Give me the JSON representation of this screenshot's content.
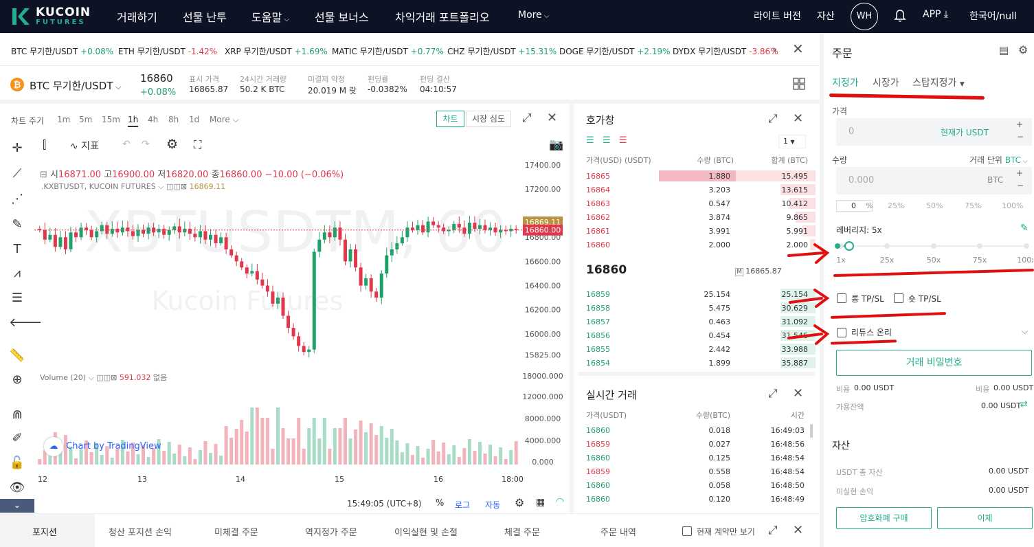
{
  "brand": {
    "name": "KUCOIN",
    "sub": "FUTURES"
  },
  "nav": {
    "items": [
      "거래하기",
      "선물 난투",
      "도움말",
      "선물 보너스",
      "차익거래 포트폴리오",
      "More"
    ],
    "right": [
      "라이트 버전",
      "자산"
    ],
    "avatar": "WH",
    "app": "APP",
    "lang": "한국어/null"
  },
  "ticker": [
    {
      "sym": "BTC 무기한/USDT",
      "chg": "+0.08%"
    },
    {
      "sym": "ETH 무기한/USDT",
      "chg": "-1.42%"
    },
    {
      "sym": "XRP 무기한/USDT",
      "chg": "+1.69%"
    },
    {
      "sym": "MATIC 무기한/USDT",
      "chg": "+0.77%"
    },
    {
      "sym": "CHZ 무기한/USDT",
      "chg": "+15.31%"
    },
    {
      "sym": "DOGE 무기한/USDT",
      "chg": "+2.19%"
    },
    {
      "sym": "DYDX 무기한/USDT",
      "chg": "-3.86%"
    }
  ],
  "summary": {
    "pair": "BTC 무기한/USDT",
    "last": "16860",
    "chg": "+0.08%",
    "stats": [
      {
        "label": "표시 가격",
        "value": "16865.87"
      },
      {
        "label": "24시간 거래량",
        "value": "50.2 K BTC"
      },
      {
        "label": "미결제 약정",
        "value": "20.019 M 랏"
      },
      {
        "label": "펀딩률",
        "value": "-0.0382%"
      },
      {
        "label": "펀딩 결산",
        "value": "04:10:57"
      }
    ]
  },
  "chart": {
    "period_label": "차트 주기",
    "intervals": [
      "1m",
      "5m",
      "15m",
      "1h",
      "4h",
      "8h",
      "1d",
      "More"
    ],
    "active_interval": "1h",
    "view_tabs": [
      "차트",
      "시장 심도"
    ],
    "indicator_label": "지표",
    "ohlc": {
      "o_label": "시",
      "o": "16871.00",
      "h_label": "고",
      "h": "16900.00",
      "l_label": "저",
      "l": "16820.00",
      "c_label": "종",
      "c": "16860.00",
      "chg": "−10.00 (−0.06%)"
    },
    "symbol_line": ".KXBTUSDT, KUCOIN FUTURES",
    "symbol_price": "16869.11",
    "watermark": "XBTUSDTM, 60",
    "watermark2": "Kucoin Futures",
    "price_ticks": [
      "17400.00",
      "17200.00",
      "16800.00",
      "16600.00",
      "16400.00",
      "16200.00",
      "16000.00",
      "15825.00"
    ],
    "tag_mark": "16869.11",
    "tag_last": "16860.00",
    "volume_label": "Volume (20)",
    "volume_value": "591.032",
    "volume_na": "없음",
    "vol_ticks": [
      "18000.000",
      "12000.000",
      "8000.000",
      "4000.000",
      "0.000"
    ],
    "dates": [
      "12",
      "13",
      "14",
      "15",
      "16",
      "18:00"
    ],
    "tv_label": "Chart by TradingView",
    "time": "15:49:05 (UTC+8)",
    "pct": "%",
    "log": "로그",
    "auto": "자동"
  },
  "orderbook": {
    "title": "호가창",
    "group": "1",
    "headers": [
      "가격(USD) (USDT)",
      "수량 (BTC)",
      "합계 (BTC)"
    ],
    "asks": [
      {
        "p": "16865",
        "q": "1.880",
        "t": "15.495",
        "d": 0.9
      },
      {
        "p": "16864",
        "q": "3.203",
        "t": "13.615",
        "d": 0.32
      },
      {
        "p": "16863",
        "q": "0.547",
        "t": "10.412",
        "d": 0.24
      },
      {
        "p": "16862",
        "q": "3.874",
        "t": "9.865",
        "d": 0.18
      },
      {
        "p": "16861",
        "q": "3.991",
        "t": "5.991",
        "d": 0.12
      },
      {
        "p": "16860",
        "q": "2.000",
        "t": "2.000",
        "d": 0.05
      }
    ],
    "mid": "16860",
    "mark_price": "16865.87",
    "bids": [
      {
        "p": "16859",
        "q": "25.154",
        "t": "25.154",
        "d": 0.32
      },
      {
        "p": "16858",
        "q": "5.475",
        "t": "30.629",
        "d": 0.32
      },
      {
        "p": "16857",
        "q": "0.463",
        "t": "31.092",
        "d": 0.32
      },
      {
        "p": "16856",
        "q": "0.454",
        "t": "31.546",
        "d": 0.32
      },
      {
        "p": "16855",
        "q": "2.442",
        "t": "33.988",
        "d": 0.32
      },
      {
        "p": "16854",
        "q": "1.899",
        "t": "35.887",
        "d": 0.32
      }
    ]
  },
  "trades": {
    "title": "실시간 거래",
    "headers": [
      "가격(USDT)",
      "수량(BTC)",
      "시간"
    ],
    "rows": [
      {
        "p": "16860",
        "q": "0.018",
        "t": "16:49:03",
        "side": "buy"
      },
      {
        "p": "16859",
        "q": "0.027",
        "t": "16:48:56",
        "side": "sell"
      },
      {
        "p": "16860",
        "q": "0.125",
        "t": "16:48:54",
        "side": "buy"
      },
      {
        "p": "16859",
        "q": "0.558",
        "t": "16:48:54",
        "side": "sell"
      },
      {
        "p": "16860",
        "q": "0.058",
        "t": "16:48:50",
        "side": "buy"
      },
      {
        "p": "16860",
        "q": "0.120",
        "t": "16:48:49",
        "side": "buy"
      }
    ]
  },
  "bottom": {
    "tabs": [
      "포지션",
      "청산 포지션 손익",
      "미체결 주문",
      "역지정가 주문",
      "이익실현 및 손절",
      "체결 주문",
      "주문 내역"
    ],
    "only_current": "현재 계약만 보기"
  },
  "order": {
    "title": "주문",
    "types": [
      "지정가",
      "시장가",
      "스탑지정가"
    ],
    "price_label": "가격",
    "price_value": "0",
    "price_suffix": "현재가 USDT",
    "qty_label": "수량",
    "unit_label": "거래 단위",
    "unit_value": "BTC",
    "qty_value": "0.000",
    "qty_suffix": "BTC",
    "pcts": [
      "0",
      "%",
      "25%",
      "50%",
      "75%",
      "100%"
    ],
    "leverage_label": "레버리지: 5x",
    "leverage_marks": [
      "1x",
      "25x",
      "50x",
      "75x",
      "100x"
    ],
    "tp_long": "롱 TP/SL",
    "tp_short": "숏 TP/SL",
    "reduce_only": "리듀스 온리",
    "pwd_button": "거래 비밀번호",
    "cost_label": "비용",
    "cost_left": "0.00 USDT",
    "cost_right": "0.00 USDT",
    "avail_label": "가용잔액",
    "avail": "0.00 USDT"
  },
  "assets": {
    "title": "자산",
    "rows": [
      {
        "label": "USDT 총 자산",
        "value": "0.00 USDT"
      },
      {
        "label": "미실현 손익",
        "value": "0.00 USDT"
      }
    ],
    "buy": "암호화폐 구매",
    "transfer": "이체"
  },
  "colors": {
    "up": "#22a06b",
    "down": "#e0384b",
    "accent": "#24ae8f",
    "annotation": "#e01010"
  },
  "chart_data": {
    "type": "candlestick",
    "title": "XBTUSDTM, 60",
    "interval": "1h",
    "x_ticks": [
      "12",
      "13",
      "14",
      "15",
      "16",
      "18:00"
    ],
    "ylim": [
      15800,
      17450
    ],
    "closes": [
      16860,
      16780,
      16820,
      16720,
      16800,
      16700,
      16840,
      16800,
      16880,
      16860,
      16800,
      16850,
      16900,
      16830,
      16870,
      16840,
      16880,
      16850,
      16810,
      16860,
      16830,
      16880,
      16840,
      16870,
      16820,
      16860,
      16890,
      16840,
      16870,
      16830,
      16800,
      16850,
      16780,
      16820,
      16750,
      16800,
      16700,
      16650,
      16600,
      16550,
      16500,
      16520,
      16450,
      16400,
      16350,
      16250,
      16300,
      16150,
      16050,
      15980,
      15900,
      15850,
      15870,
      16680,
      16780,
      16840,
      16800,
      16880,
      16780,
      16600,
      16700,
      16550,
      16400,
      16460,
      16350,
      16300,
      16500,
      16650,
      16700,
      16750,
      16800,
      16880,
      16860,
      16900,
      16840,
      16930,
      16900,
      16880,
      16850,
      16860,
      16910,
      16880,
      16830,
      16920,
      16870,
      16900,
      16860,
      16880,
      16840,
      16860,
      16850,
      16870,
      16860
    ]
  }
}
